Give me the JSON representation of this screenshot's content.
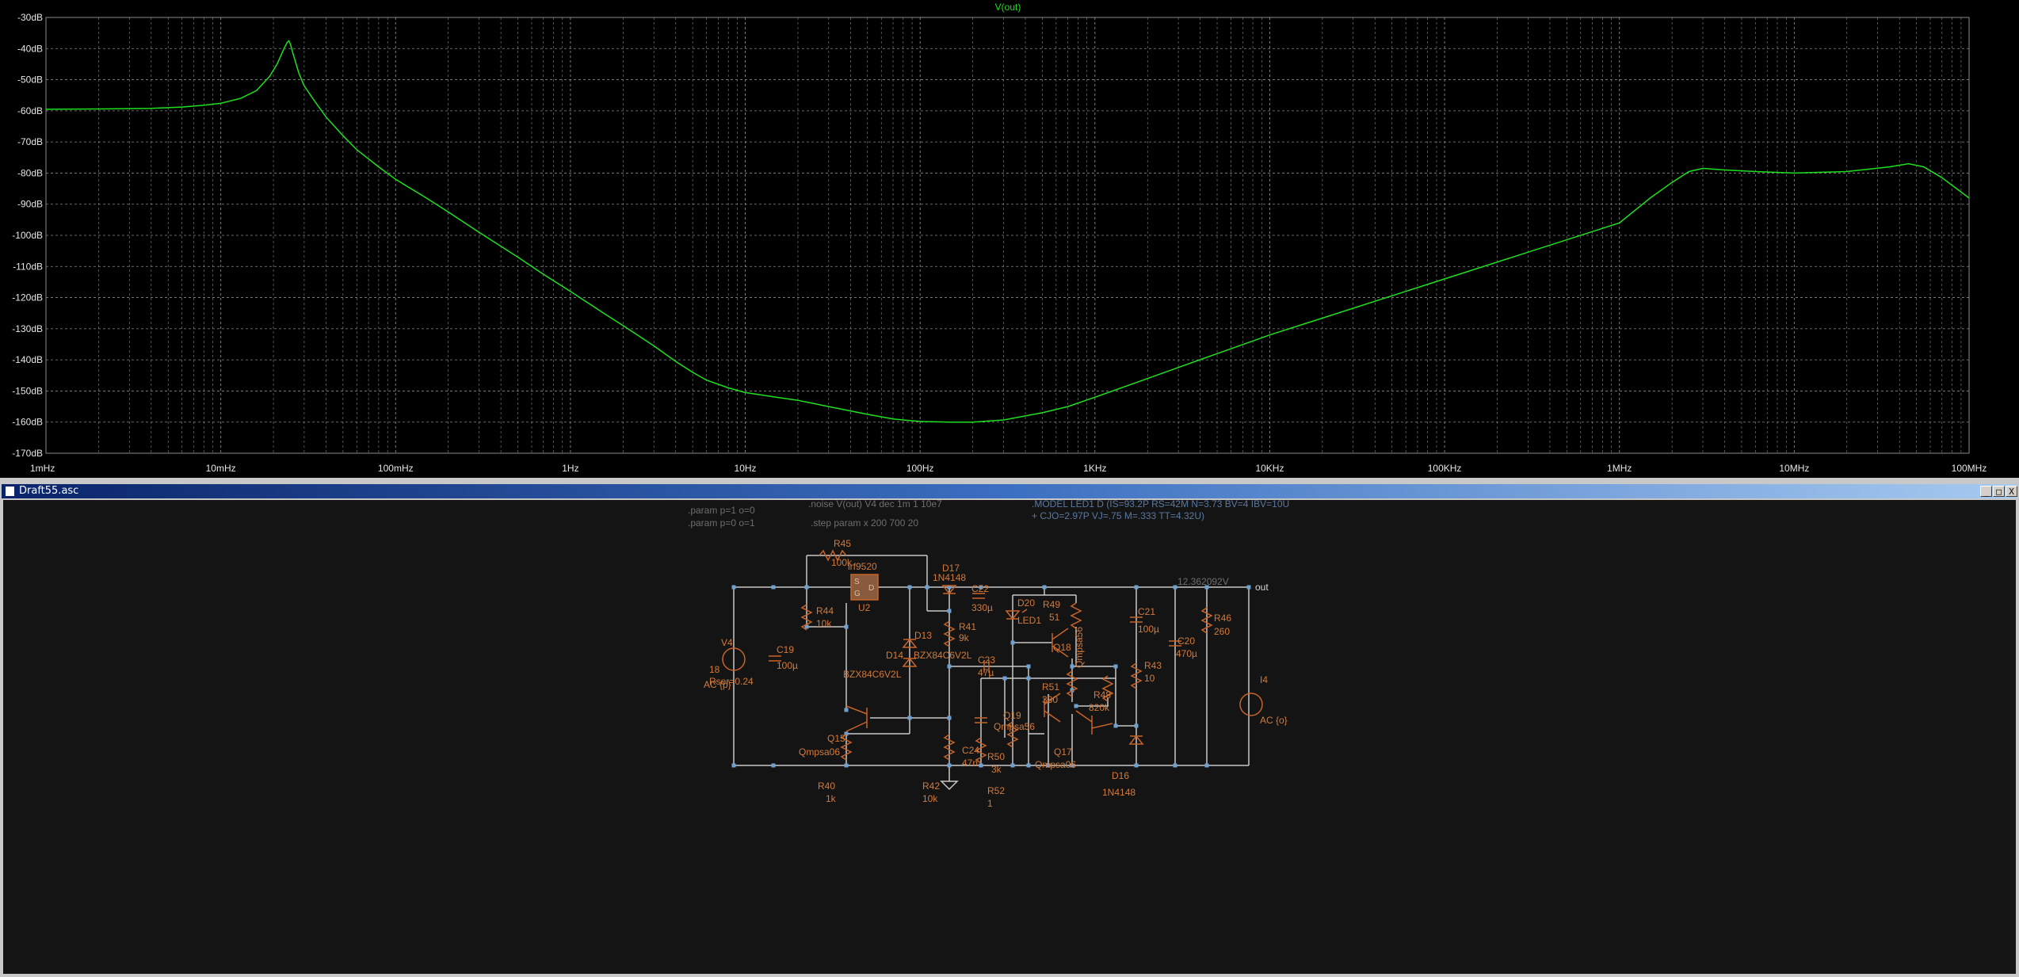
{
  "plot": {
    "trace_label": "V(out)",
    "colors": {
      "background": "#000000",
      "trace": "#1ee01e",
      "grid": "#8a8a8a",
      "axis_text": "#e6e6e6"
    },
    "y_ticks": [
      "-30dB",
      "-40dB",
      "-50dB",
      "-60dB",
      "-70dB",
      "-80dB",
      "-90dB",
      "-100dB",
      "-110dB",
      "-120dB",
      "-130dB",
      "-140dB",
      "-150dB",
      "-160dB",
      "-170dB"
    ],
    "x_ticks": [
      "1mHz",
      "10mHz",
      "100mHz",
      "1Hz",
      "10Hz",
      "100Hz",
      "1KHz",
      "10KHz",
      "100KHz",
      "1MHz",
      "10MHz",
      "100MHz"
    ]
  },
  "chart_data": {
    "type": "line",
    "series": [
      {
        "name": "V(out)",
        "x": [
          0.001,
          0.002,
          0.004,
          0.006,
          0.008,
          0.01,
          0.013,
          0.016,
          0.019,
          0.021,
          0.023,
          0.024,
          0.0245,
          0.025,
          0.026,
          0.028,
          0.03,
          0.035,
          0.04,
          0.05,
          0.06,
          0.08,
          0.1,
          0.15,
          0.2,
          0.3,
          0.5,
          0.7,
          1,
          1.5,
          2,
          3,
          4,
          5,
          6,
          8,
          10,
          15,
          20,
          30,
          50,
          70,
          100,
          150,
          200,
          300,
          500,
          700,
          1000,
          2000,
          5000,
          10000,
          100000,
          1000000,
          1500000,
          2000000,
          2500000,
          3000000,
          4000000,
          6000000,
          10000000,
          20000000,
          35000000,
          45000000,
          55000000,
          70000000,
          100000000
        ],
        "y": [
          -59.5,
          -59.4,
          -59.2,
          -58.8,
          -58.2,
          -57.6,
          -56,
          -53.5,
          -49,
          -45,
          -40,
          -38,
          -37.5,
          -38.5,
          -42,
          -48,
          -52,
          -57.5,
          -62,
          -68,
          -72.5,
          -78,
          -82,
          -88,
          -92.5,
          -99,
          -107,
          -112.5,
          -118,
          -124.5,
          -129,
          -135.5,
          -140.5,
          -144,
          -146.5,
          -149,
          -150.5,
          -152,
          -153,
          -155,
          -157.5,
          -159,
          -159.8,
          -160,
          -160,
          -159.3,
          -157,
          -155,
          -152,
          -146,
          -138,
          -132,
          -114,
          -96,
          -88,
          -83,
          -79.5,
          -78.5,
          -79,
          -79.5,
          -80,
          -79.5,
          -78,
          -77,
          -78,
          -81.5,
          -88
        ]
      }
    ],
    "x_scale": "log",
    "xlim": [
      0.001,
      100000000
    ],
    "ylim": [
      -170,
      -30
    ],
    "xlabel": "",
    "ylabel": "",
    "grid": true,
    "legend": "top-center"
  },
  "schematic": {
    "window_title": "Draft55.asc",
    "buttons": {
      "minimize": "_",
      "maximize": "□",
      "close": "X"
    },
    "colors": {
      "wire": "#c8c8c8",
      "component": "#c86428",
      "text": "#d27a3c",
      "directive": "#5a78a0",
      "directive_dim": "#6e6e6e",
      "node": "#6ea0d2",
      "net_label": "#d8d8d8",
      "bg": "#141414"
    },
    "directives": {
      "param1": ".param p=1 o=0",
      "param2": ".param p=0 o=1",
      "noise": ".noise V(out) V4 dec 1m 1 10e7",
      "step": ".step param x 200 700 20",
      "model1": ".MODEL LED1 D (IS=93.2P RS=42M N=3.73 BV=4 IBV=10U",
      "model2": "+ CJO=2.97P VJ=.75 M=.333 TT=4.32U)"
    },
    "net_label_out": "out",
    "voltage_readout": "12.362092V",
    "components": {
      "R45": {
        "ref": "R45",
        "val": "100k"
      },
      "U2": {
        "ref": "U2",
        "val": "irf9520"
      },
      "D17": {
        "ref": "D17",
        "val": "1N4148"
      },
      "C22": {
        "ref": "C22",
        "val": "330µ"
      },
      "R44": {
        "ref": "R44",
        "val": "10k"
      },
      "R41": {
        "ref": "R41",
        "val": "9k"
      },
      "D20": {
        "ref": "D20",
        "val": "LED1"
      },
      "R49": {
        "ref": "R49",
        "val": "51"
      },
      "Q18": {
        "ref": "Q18",
        "val": "Qmpsa56"
      },
      "C21": {
        "ref": "C21",
        "val": "100µ"
      },
      "R46": {
        "ref": "R46",
        "val": "260"
      },
      "C20": {
        "ref": "C20",
        "val": "470µ"
      },
      "V4": {
        "ref": "V4",
        "val": "18",
        "val2": "Rser=0.24",
        "val3": "AC {p}"
      },
      "C19": {
        "ref": "C19",
        "val": "100µ"
      },
      "D13": {
        "ref": "D13",
        "val": "BZX84C6V2L"
      },
      "D14": {
        "ref": "D14",
        "val": "BZX84C6V2L"
      },
      "C23": {
        "ref": "C23",
        "val": "47µ"
      },
      "R43": {
        "ref": "R43",
        "val": "10"
      },
      "I4": {
        "ref": "I4",
        "val": "AC {o}"
      },
      "R51": {
        "ref": "R51",
        "val": "330"
      },
      "R48": {
        "ref": "R48",
        "val": "820k"
      },
      "Q19": {
        "ref": "Q19",
        "val": "Qmpsa56"
      },
      "Q15": {
        "ref": "Q15",
        "val": "Qmpsa06"
      },
      "C24": {
        "ref": "C24",
        "val": "47n"
      },
      "R50": {
        "ref": "R50",
        "val": "3k"
      },
      "Q17": {
        "ref": "Q17",
        "val": "Qmpsa06"
      },
      "D16": {
        "ref": "D16",
        "val": "1N4148"
      },
      "R40": {
        "ref": "R40",
        "val": "1k"
      },
      "R42": {
        "ref": "R42",
        "val": "10k"
      },
      "R52": {
        "ref": "R52",
        "val": "1"
      }
    }
  }
}
